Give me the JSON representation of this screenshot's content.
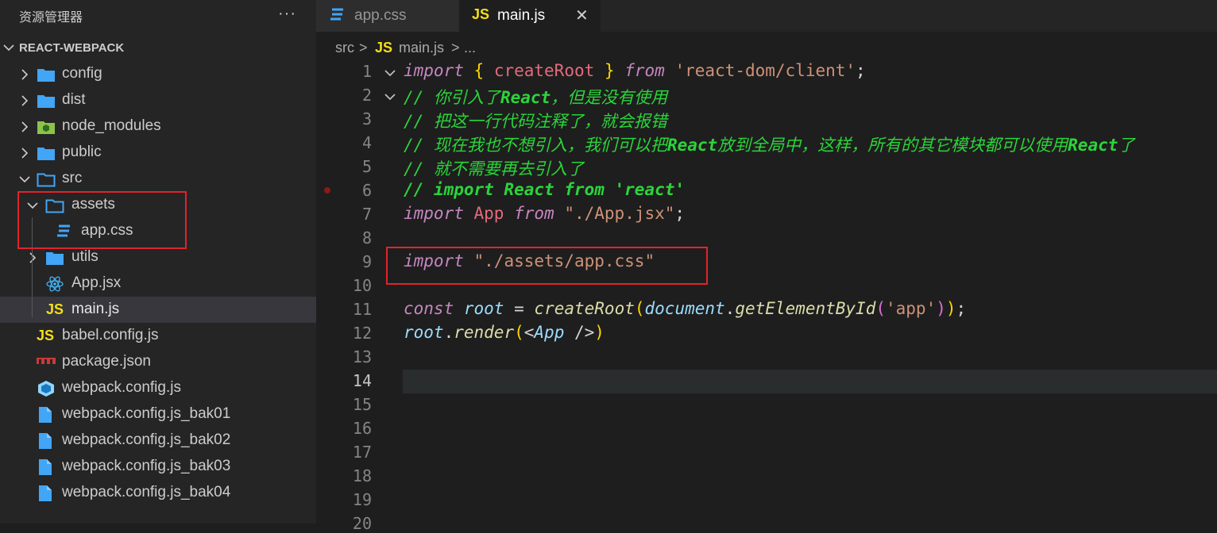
{
  "sidebar": {
    "title": "资源管理器",
    "more": "···",
    "section": "REACT-WEBPACK",
    "items": [
      {
        "label": "config",
        "icon": "folder-icon"
      },
      {
        "label": "dist",
        "icon": "folder-icon"
      },
      {
        "label": "node_modules",
        "icon": "node-folder-icon"
      },
      {
        "label": "public",
        "icon": "folder-icon"
      },
      {
        "label": "src",
        "icon": "folder-open-icon"
      },
      {
        "label": "assets",
        "icon": "folder-open-icon"
      },
      {
        "label": "app.css",
        "icon": "css-icon"
      },
      {
        "label": "utils",
        "icon": "folder-icon"
      },
      {
        "label": "App.jsx",
        "icon": "react-icon"
      },
      {
        "label": "main.js",
        "icon": "js-icon"
      },
      {
        "label": "babel.config.js",
        "icon": "js-icon"
      },
      {
        "label": "package.json",
        "icon": "npm-icon"
      },
      {
        "label": "webpack.config.js",
        "icon": "webpack-icon"
      },
      {
        "label": "webpack.config.js_bak01",
        "icon": "file-icon"
      },
      {
        "label": "webpack.config.js_bak02",
        "icon": "file-icon"
      },
      {
        "label": "webpack.config.js_bak03",
        "icon": "file-icon"
      },
      {
        "label": "webpack.config.js_bak04",
        "icon": "file-icon"
      }
    ]
  },
  "tabs": [
    {
      "label": "app.css",
      "badge": "",
      "active": false
    },
    {
      "label": "main.js",
      "badge": "JS",
      "active": true,
      "close": "✕"
    }
  ],
  "breadcrumb": {
    "folder": "src",
    "sep": ">",
    "badge": "JS",
    "file": "main.js",
    "ellipsis": "..."
  },
  "editor": {
    "line_numbers": [
      "1",
      "2",
      "3",
      "4",
      "5",
      "6",
      "7",
      "8",
      "9",
      "10",
      "11",
      "12",
      "13",
      "14",
      "15",
      "16",
      "17",
      "18",
      "19",
      "20"
    ],
    "current_line": "14",
    "code": {
      "l1_import": "import",
      "l1_brace_open": "{",
      "l1_name": "createRoot",
      "l1_brace_close": "}",
      "l1_from": "from",
      "l1_module": "'react-dom/client'",
      "l1_semi": ";",
      "l2_a": "// 你引入了",
      "l2_b": "React",
      "l2_c": "，但是没有使用",
      "l3": "// 把这一行代码注释了，就会报错",
      "l4_a": "// 现在我也不想引入，我们可以把",
      "l4_b": "React",
      "l4_c": "放到全局中，这样，所有的其它模块都可以使用",
      "l4_d": "React",
      "l4_e": "了",
      "l5": "// 就不需要再去引入了",
      "l6": "// import React from 'react'",
      "l7_import": "import",
      "l7_name": "App",
      "l7_from": "from",
      "l7_module": "\"./App.jsx\"",
      "l7_semi": ";",
      "l9_import": "import",
      "l9_module": "\"./assets/app.css\"",
      "l11_const": "const",
      "l11_root": "root",
      "l11_eq": "=",
      "l11_fn": "createRoot",
      "l11_p_open": "(",
      "l11_doc": "document",
      "l11_dot": ".",
      "l11_get": "getElementById",
      "l11_pp_open": "(",
      "l11_arg": "'app'",
      "l11_pp_close": ")",
      "l11_p_close": ")",
      "l11_semi": ";",
      "l12_root": "root",
      "l12_dot": ".",
      "l12_render": "render",
      "l12_p_open": "(",
      "l12_lt": "<",
      "l12_app": "App",
      "l12_end": " />",
      "l12_p_close": ")"
    }
  },
  "colors": {
    "highlight_box": "#e0242c",
    "comment": "#2bd43a",
    "keyword": "#c586c0"
  }
}
